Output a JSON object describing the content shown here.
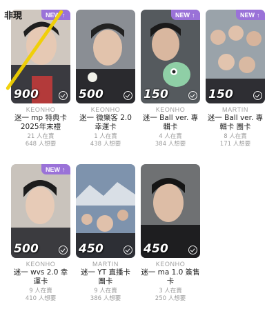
{
  "sold_label": "非現",
  "colors": {
    "new_badge": "#9a72d8",
    "strike": "#f0d000"
  },
  "cards": [
    {
      "artist": "KEONHO",
      "title": "迷一 mp 特典卡\n2025年末禮",
      "price": "900",
      "new": "NEW",
      "want": "21 人在賣",
      "sell": "648 人想要",
      "new_icon": "arrow-up-icon"
    },
    {
      "artist": "KEONHO",
      "title": "迷一 微樂客 2.0\n幸運卡",
      "price": "500",
      "want": "1 人在賣",
      "sell": "438 人想要"
    },
    {
      "artist": "KEONHO",
      "title": "迷一 Ball ver. 專\n輯卡",
      "price": "150",
      "new": "NEW",
      "want": "4 人在賣",
      "sell": "384 人想要"
    },
    {
      "artist": "MARTIN",
      "title": "迷一 Ball ver. 專\n輯卡 團卡",
      "price": "150",
      "new": "NEW",
      "want": "8 人在賣",
      "sell": "171 人想要"
    },
    {
      "artist": "KEONHO",
      "title": "迷一 wvs 2.0 幸\n運卡",
      "price": "500",
      "new": "NEW",
      "want": "9 人在賣",
      "sell": "410 人想要"
    },
    {
      "artist": "MARTIN",
      "title": "迷一 YT 直播卡\n團卡",
      "price": "450",
      "want": "9 人在賣",
      "sell": "386 人想要"
    },
    {
      "artist": "KEONHO",
      "title": "迷一 ma 1.0 簽售\n卡",
      "price": "450",
      "want": "3 人在賣",
      "sell": "250 人想要"
    }
  ]
}
